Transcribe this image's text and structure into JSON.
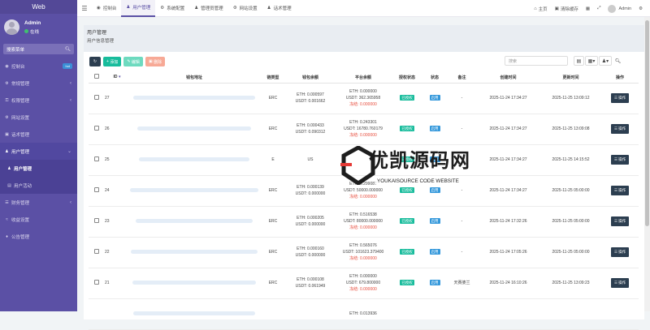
{
  "sidebar": {
    "brand": "Web",
    "user": {
      "name": "Admin",
      "status": "在线"
    },
    "search_placeholder": "搜索菜单",
    "items": [
      {
        "icon": "dashboard-icon",
        "label": "控制台",
        "badge": "hot"
      },
      {
        "icon": "cogs-icon",
        "label": "常规管理"
      },
      {
        "icon": "key-icon",
        "label": "权限管理"
      },
      {
        "icon": "settings-icon",
        "label": "网站设置"
      },
      {
        "icon": "chat-icon",
        "label": "话术管理"
      },
      {
        "icon": "user-icon",
        "label": "用户管理"
      },
      {
        "icon": "user-icon",
        "label": "用户管理"
      },
      {
        "icon": "activity-icon",
        "label": "用户活动"
      },
      {
        "icon": "finance-icon",
        "label": "财务管理"
      },
      {
        "icon": "chart-icon",
        "label": "收益设置"
      },
      {
        "icon": "bell-icon",
        "label": "公告管理"
      }
    ]
  },
  "topbar": {
    "tabs": [
      {
        "icon": "dashboard-icon",
        "label": "控制台"
      },
      {
        "icon": "user-icon",
        "label": "用户管理"
      },
      {
        "icon": "gear-icon",
        "label": "系统配置"
      },
      {
        "icon": "user-icon",
        "label": "管理员管理"
      },
      {
        "icon": "settings-icon",
        "label": "网站设置"
      },
      {
        "icon": "group-icon",
        "label": "话术管理"
      }
    ],
    "right": {
      "home": "主页",
      "clear_cache": "清除缓存",
      "user": "Admin"
    }
  },
  "breadcrumb": {
    "title": "用户管理",
    "subtitle": "用户信息管理"
  },
  "toolbar": {
    "add": "添加",
    "edit": "编辑",
    "delete": "删除",
    "search_placeholder": "搜索"
  },
  "table": {
    "headers": [
      "",
      "ID",
      "钱包地址",
      "链类型",
      "钱包余额",
      "平台余额",
      "授权状态",
      "状态",
      "备注",
      "创建时间",
      "更新时间",
      "操作"
    ],
    "rows": [
      {
        "id": "27",
        "chain": "ERC",
        "eth": "ETH: 0.000597",
        "usdt": "USDT: 0.001662",
        "p1": "ETH: 0.000000",
        "p2": "USDT: 362.365958",
        "p3": "冻结: 0.000000",
        "auth": "已授权",
        "status": "启用",
        "remark": "-",
        "created": "2025-11-24 17:34:27",
        "updated": "2025-11-25 13:09:12",
        "op": "操作"
      },
      {
        "id": "26",
        "chain": "ERC",
        "eth": "ETH: 0.000433",
        "usdt": "USDT: 0.090312",
        "p1": "ETH: 0.243301",
        "p2": "USDT: 16780.760179",
        "p3": "冻结: 0.000000",
        "auth": "已授权",
        "status": "启用",
        "remark": "-",
        "created": "2025-11-24 17:34:27",
        "updated": "2025-11-25 13:09:08",
        "op": "操作"
      },
      {
        "id": "25",
        "chain": "E",
        "eth": "",
        "usdt": "US",
        "p1": "",
        "p2": "",
        "p3": "",
        "auth": "已授权",
        "status": "启用",
        "remark": "-",
        "created": "2025-11-24 17:34:27",
        "updated": "2025-11-25 14:15:52",
        "op": "操作"
      },
      {
        "id": "24",
        "chain": "ERC",
        "eth": "ETH: 0.000139",
        "usdt": "USDT: 0.000000",
        "p1": "ETH: 0.299087",
        "p2": "USDT: 50000.000000",
        "p3": "冻结: 0.000000",
        "auth": "已授权",
        "status": "启用",
        "remark": "-",
        "created": "2025-11-24 17:34:27",
        "updated": "2025-11-25 05:00:00",
        "op": "操作"
      },
      {
        "id": "23",
        "chain": "ERC",
        "eth": "ETH: 0.000205",
        "usdt": "USDT: 0.000000",
        "p1": "ETH: 0.516538",
        "p2": "USDT: 80000.000000",
        "p3": "冻结: 0.000000",
        "auth": "已授权",
        "status": "启用",
        "remark": "-",
        "created": "2025-11-24 17:32:26",
        "updated": "2025-11-25 05:00:00",
        "op": "操作"
      },
      {
        "id": "22",
        "chain": "ERC",
        "eth": "ETH: 0.000160",
        "usdt": "USDT: 0.000000",
        "p1": "ETH: 0.565076",
        "p2": "USDT: 101623.379400",
        "p3": "冻结: 0.000000",
        "auth": "已授权",
        "status": "启用",
        "remark": "-",
        "created": "2025-11-24 17:05:26",
        "updated": "2025-11-25 05:00:00",
        "op": "操作"
      },
      {
        "id": "21",
        "chain": "ERC",
        "eth": "ETH: 0.000108",
        "usdt": "USDT: 0.061949",
        "p1": "ETH: 0.000000",
        "p2": "USDT: 679.800000",
        "p3": "冻结: 0.000000",
        "auth": "已授权",
        "status": "启用",
        "remark": "天赛婆兰",
        "created": "2025-11-24 16:10:26",
        "updated": "2025-11-25 13:09:23",
        "op": "操作"
      },
      {
        "id": "",
        "chain": "",
        "eth": "",
        "usdt": "",
        "p1": "ETH: 0.013936",
        "p2": "",
        "p3": "",
        "auth": "",
        "status": "",
        "remark": "",
        "created": "",
        "updated": "",
        "op": ""
      }
    ]
  },
  "watermark": {
    "title": "优凯源码网",
    "subtitle": "YOUKAISOURCE CODE WEBSITE"
  },
  "colors": {
    "sidebar": "#5b50a5",
    "success": "#18bc9c",
    "info": "#3498db",
    "danger": "#e74c3c",
    "dark": "#2c3e50"
  }
}
